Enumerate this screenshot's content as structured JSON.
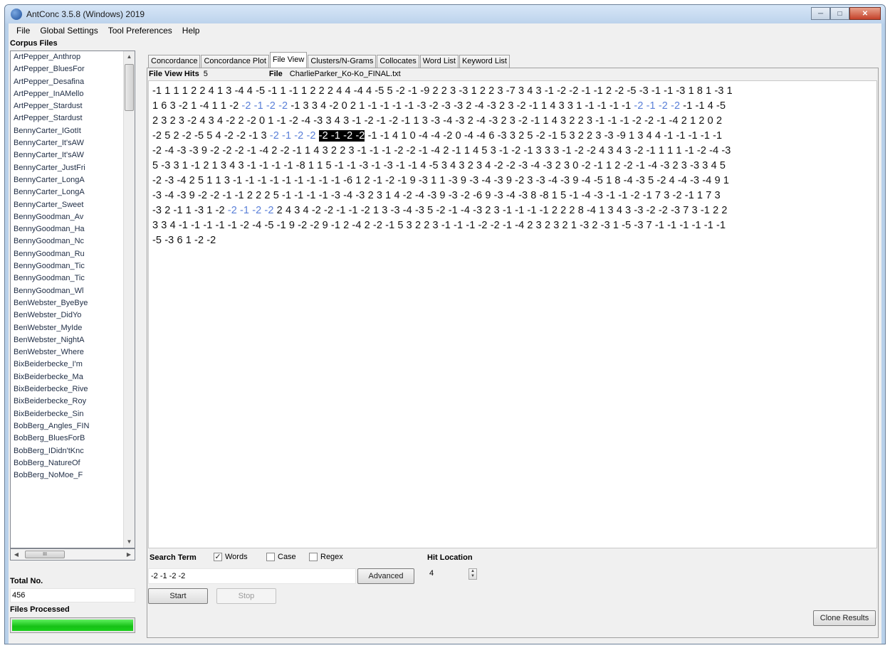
{
  "window": {
    "title": "AntConc 3.5.8 (Windows) 2019"
  },
  "menu": [
    "File",
    "Global Settings",
    "Tool Preferences",
    "Help"
  ],
  "sidebar": {
    "corpus_label": "Corpus Files",
    "files": [
      "ArtPepper_Anthrop",
      "ArtPepper_BluesFor",
      "ArtPepper_Desafina",
      "ArtPepper_InAMello",
      "ArtPepper_Stardust",
      "ArtPepper_Stardust",
      "BennyCarter_IGotIt",
      "BennyCarter_It'sAW",
      "BennyCarter_It'sAW",
      "BennyCarter_JustFri",
      "BennyCarter_LongA",
      "BennyCarter_LongA",
      "BennyCarter_Sweet",
      "BennyGoodman_Av",
      "BennyGoodman_Ha",
      "BennyGoodman_Nc",
      "BennyGoodman_Ru",
      "BennyGoodman_Tic",
      "BennyGoodman_Tic",
      "BennyGoodman_Wl",
      "BenWebster_ByeBye",
      "BenWebster_DidYo",
      "BenWebster_MyIde",
      "BenWebster_NightA",
      "BenWebster_Where",
      "BixBeiderbecke_I'm",
      "BixBeiderbecke_Ma",
      "BixBeiderbecke_Rive",
      "BixBeiderbecke_Roy",
      "BixBeiderbecke_Sin",
      "BobBerg_Angles_FIN",
      "BobBerg_BluesForB",
      "BobBerg_IDidn'tKnc",
      "BobBerg_NatureOf",
      "BobBerg_NoMoe_F"
    ],
    "hscroll_thumb": "III",
    "total_label": "Total No.",
    "total_value": "456",
    "files_processed_label": "Files Processed",
    "progress_fraction": 1.0,
    "progress_color": "#16c116"
  },
  "tabs": [
    "Concordance",
    "Concordance Plot",
    "File View",
    "Clusters/N-Grams",
    "Collocates",
    "Word List",
    "Keyword List"
  ],
  "active_tab": "File View",
  "file_view": {
    "hits_label": "File View Hits",
    "hits_value": "5",
    "file_label": "File",
    "file_value": "CharlieParker_Ko-Ko_FINAL.txt",
    "lines": [
      [
        {
          "t": "-1 1 1 1 2 2 4 1 3 -4 4 -5 -1 1 -1 1 2 2 2 4 4 -4 4 -5 5 -2 -1 -9 2 2 3 -3 1 2 2 3 -7 3 4 3 -1 -2 -2 -1 -1 2 -2 -5 -3 -1 -1 -3 1 8 1 -3 1"
        }
      ],
      [
        {
          "t": "1 6 3 -2 1 -4 1 1 -2 "
        },
        {
          "t": "-2 -1 -2 -2",
          "c": "blue"
        },
        {
          "t": " -1 3 3 4 -2 0 2 1 -1 -1 -1 -1 -3 -2 -3 -3 2 -4 -3 2 3 -2 -1 1 4 3 3 1 -1 -1 -1 -1 "
        },
        {
          "t": "-2 -1 -2 -2",
          "c": "blue"
        },
        {
          "t": " -1 -1 4 -5"
        }
      ],
      [
        {
          "t": "2 3 2 3 -2 4 3 4 -2 2 -2 0 1 -1 -2 -4 -3 3 4 3 -1 -2 -1 -2 -1 1 3 -3 -4 -3 2 -4 -3 2 3 -2 -1 1 4 3 2 2 3 -1 -1 -1 -2 -2 -1 -4 2 1 2 0 2"
        }
      ],
      [
        {
          "t": "-2 5 2 -2 -5 5 4 -2 -2 -1 3 "
        },
        {
          "t": "-2 -1 -2 -2",
          "c": "blue"
        },
        {
          "t": " "
        },
        {
          "t": "-2 -1 -2 -2",
          "c": "hl"
        },
        {
          "t": " -1 -1 4 1 0 -4 -4 -2 0 -4 -4 6 -3 3 2 5 -2 -1 5 3 2 2 3 -3 -9 1 3 4 4 -1 -1 -1 -1 -1"
        }
      ],
      [
        {
          "t": "-2 -4 -3 -3 9 -2 -2 -2 -1 -4 2 -2 -1 1 4 3 2 2 3 -1 -1 -1 -2 -2 -1 -4 2 -1 1 4 5 3 -1 -2 -1 3 3 3 -1 -2 -2 4 3 4 3 -2 -1 1 1 1 -1 -2 -4 -3"
        }
      ],
      [
        {
          "t": "5 -3 3 1 -1 2 1 3 4 3 -1 -1 -1 -1 -8 1 1 5 -1 -1 -3 -1 -3 -1 -1 4 -5 3 4 3 2 3 4 -2 -2 -3 -4 -3 2 3 0 -2 -1 1 2 -2 -1 -4 -3 2 3 -3 3 4 5"
        }
      ],
      [
        {
          "t": "-2 -3 -4 2 5 1 1 3 -1 -1 -1 -1 -1 -1 -1 -1 -1 -6 1 2 -1 -2 -1 9 -3 1 1 -3 9 -3 -4 -3 9 -2 3 -3 -4 -3 9 -4 -5 1 8 -4 -3 5 -2 4 -4 -3 -4 9 1"
        }
      ],
      [
        {
          "t": "-3 -4 -3 9 -2 -2 -1 -1 2 2 2 5 -1 -1 -1 -1 -3 -4 -3 2 3 1 4 -2 -4 -3 9 -3 -2 -6 9 -3 -4 -3 8 -8 1 5 -1 -4 -3 -1 -1 -2 -1 7 3 -2 -1 1 7 3"
        }
      ],
      [
        {
          "t": "-3 2 -1 1 -3 1 -2 "
        },
        {
          "t": "-2 -1 -2 -2",
          "c": "blue"
        },
        {
          "t": " 2 4 3 4 -2 -2 -1 -1 -2 1 3 -3 -4 -3 5 -2 -1 -4 -3 2 3 -1 -1 -1 -1 2 2 2 8 -4 1 3 4 3 -3 -2 -2 -3 7 3 -1 2 2"
        }
      ],
      [
        {
          "t": "3 3 4 -1 -1 -1 -1 -1 -2 -4 -5 -1 9 -2 -2 9 -1 2 -4 2 -2 -1 5 3 2 2 3 -1 -1 -1 -2 -2 -1 -4 2 3 2 3 2 1 -3 2 -3 1 -5 -3 7 -1 -1 -1 -1 -1 -1"
        }
      ],
      [
        {
          "t": "-5 -3 6 1 -2 -2"
        }
      ]
    ]
  },
  "search": {
    "term_label": "Search Term",
    "words_label": "Words",
    "words_checked": true,
    "case_label": "Case",
    "case_checked": false,
    "regex_label": "Regex",
    "regex_checked": false,
    "query": "-2 -1 -2 -2",
    "advanced_label": "Advanced",
    "hit_location_label": "Hit Location",
    "hit_location_value": "4",
    "start_label": "Start",
    "stop_label": "Stop",
    "clone_label": "Clone Results"
  }
}
